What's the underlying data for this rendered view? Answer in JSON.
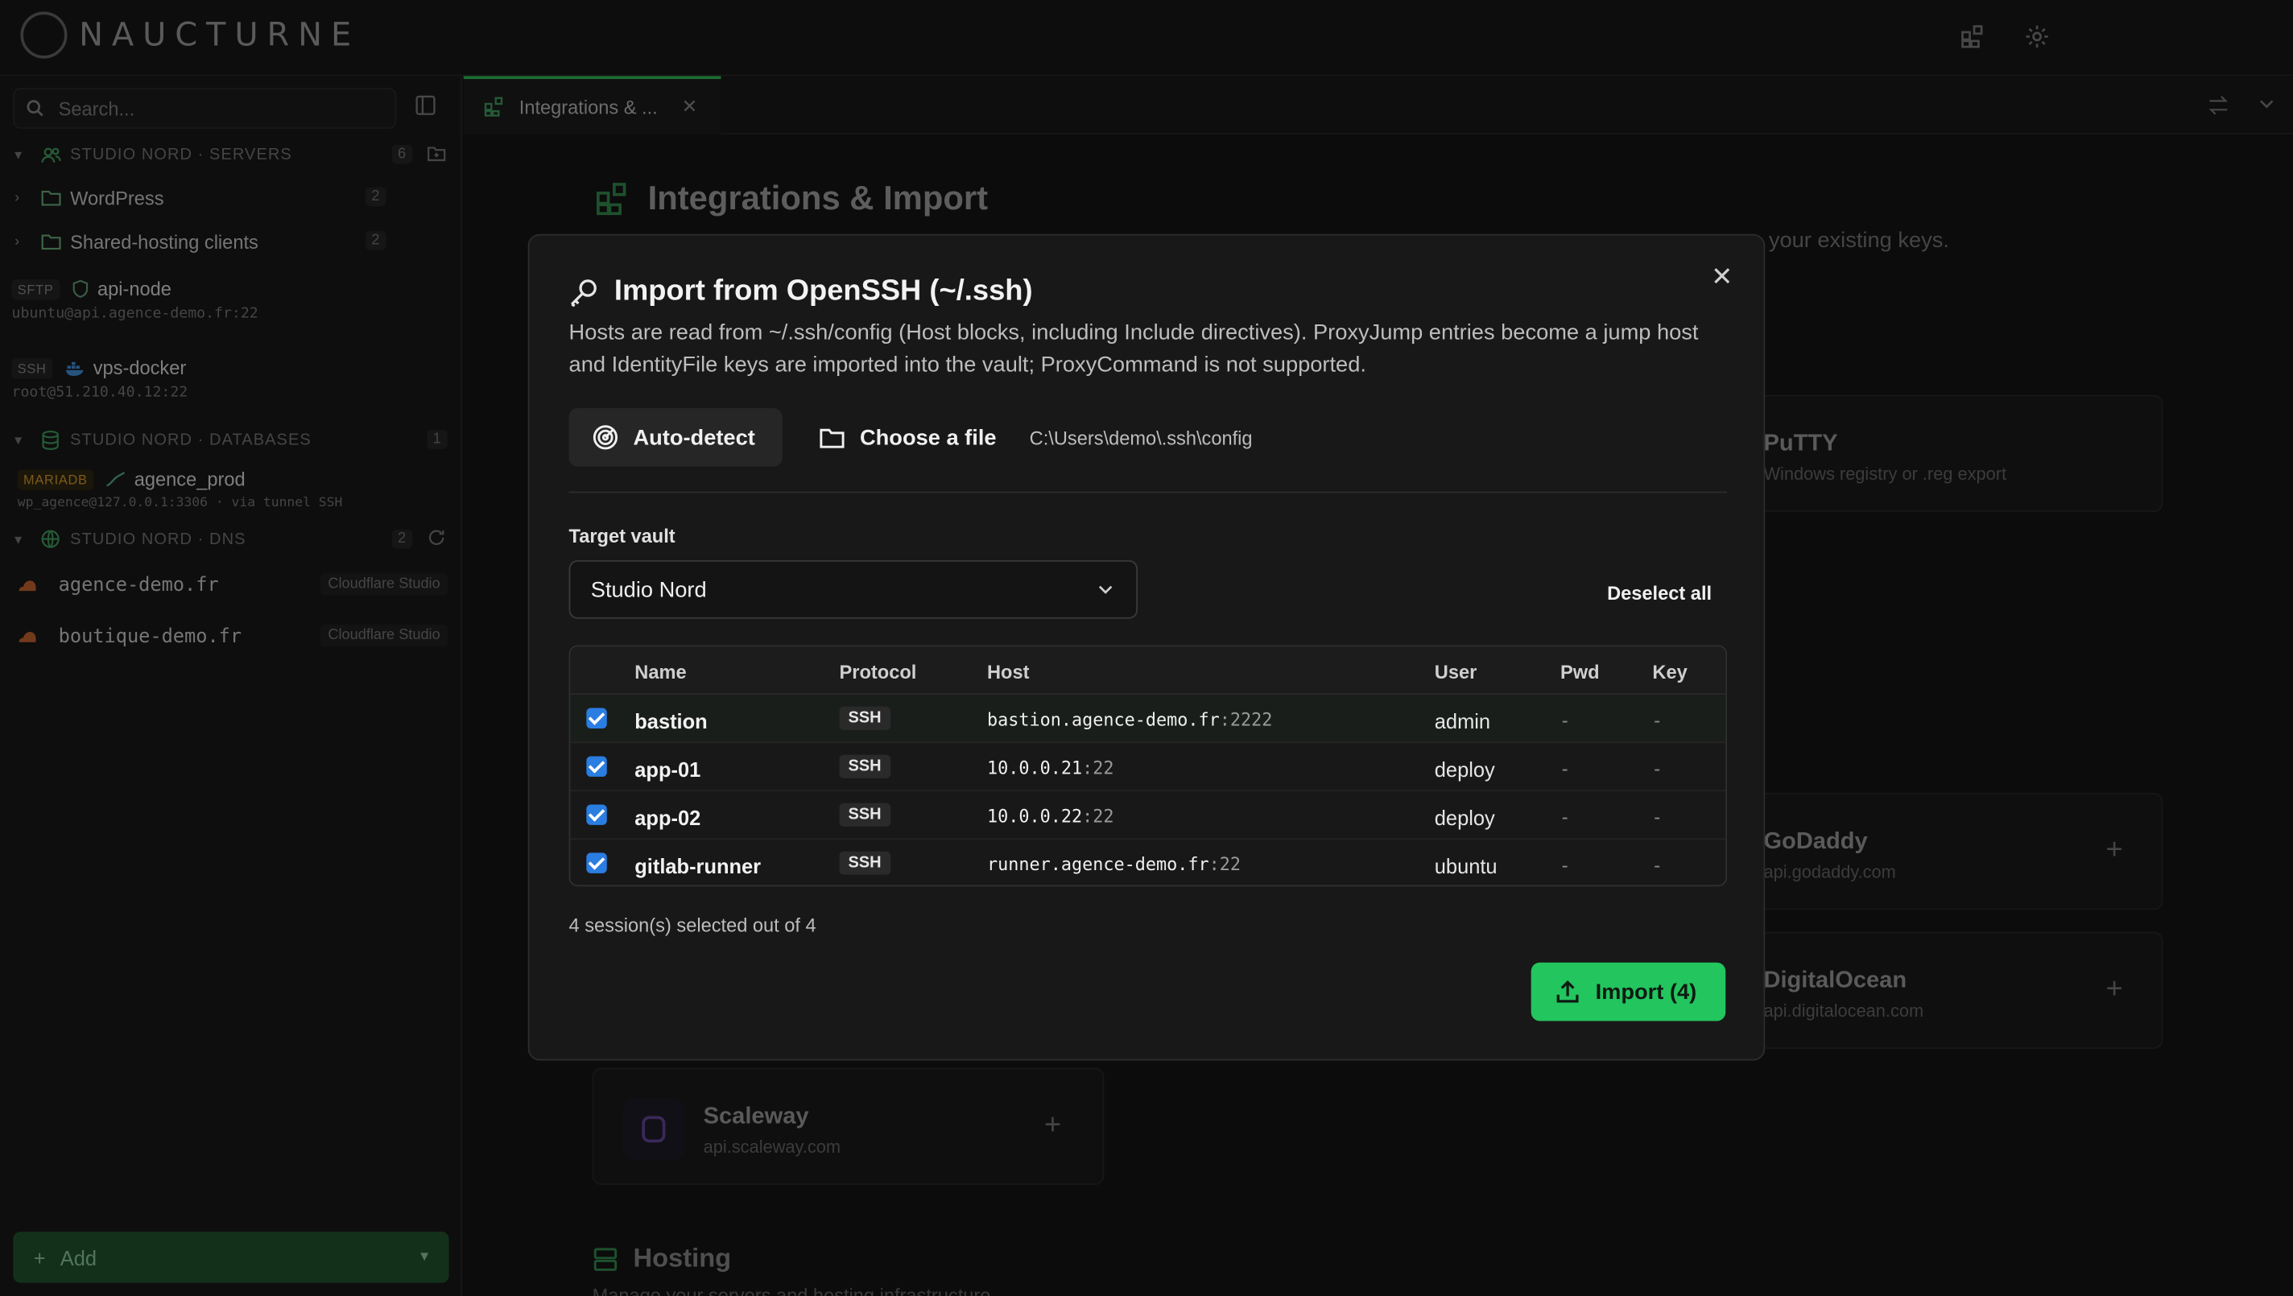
{
  "app": {
    "name": "NAUCTURNE"
  },
  "sidebar": {
    "search_placeholder": "Search...",
    "groups": [
      {
        "label": "STUDIO NORD · SERVERS",
        "count": "6"
      },
      {
        "label": "STUDIO NORD · DATABASES",
        "count": "1"
      },
      {
        "label": "STUDIO NORD · DNS",
        "count": "2"
      }
    ],
    "folders": [
      {
        "label": "WordPress",
        "count": "2"
      },
      {
        "label": "Shared-hosting clients",
        "count": "2"
      }
    ],
    "connections": [
      {
        "protocol": "SFTP",
        "name": "api-node",
        "detail": "ubuntu@api.agence-demo.fr:22"
      },
      {
        "protocol": "SSH",
        "name": "vps-docker",
        "detail": "root@51.210.40.12:22"
      }
    ],
    "database": {
      "badge": "MARIADB",
      "name": "agence_prod",
      "detail": "wp_agence@127.0.0.1:3306 · via tunnel SSH"
    },
    "dns": [
      {
        "name": "agence-demo.fr",
        "tag": "Cloudflare Studio"
      },
      {
        "name": "boutique-demo.fr",
        "tag": "Cloudflare Studio"
      }
    ],
    "add_label": "Add"
  },
  "tabs": [
    {
      "label": "Integrations & ..."
    }
  ],
  "page": {
    "title": "Integrations & Import",
    "subtitle_fragment": "e your existing keys.",
    "cards": [
      {
        "title": "PuTTY",
        "sub": "Windows registry or .reg export"
      },
      {
        "title": "GoDaddy",
        "sub": "api.godaddy.com"
      },
      {
        "title": "DigitalOcean",
        "sub": "api.digitalocean.com"
      },
      {
        "title": "Scaleway",
        "sub": "api.scaleway.com"
      }
    ],
    "hosting_title": "Hosting",
    "hosting_sub": "Manage your servers and hosting infrastructure"
  },
  "modal": {
    "title": "Import from OpenSSH (~/.ssh)",
    "description": "Hosts are read from ~/.ssh/config (Host blocks, including Include directives). ProxyJump entries become a jump host and IdentityFile keys are imported into the vault; ProxyCommand is not supported.",
    "auto_detect": "Auto-detect",
    "choose_file": "Choose a file",
    "path": "C:\\Users\\demo\\.ssh\\config",
    "target_vault_label": "Target vault",
    "target_vault_value": "Studio Nord",
    "deselect_all": "Deselect all",
    "columns": [
      "Name",
      "Protocol",
      "Host",
      "User",
      "Pwd",
      "Key"
    ],
    "rows": [
      {
        "checked": true,
        "name": "bastion",
        "protocol": "SSH",
        "host": "bastion.agence-demo.fr",
        "port": ":2222",
        "user": "admin",
        "pwd": "-",
        "key": "-"
      },
      {
        "checked": true,
        "name": "app-01",
        "protocol": "SSH",
        "host": "10.0.0.21",
        "port": ":22",
        "user": "deploy",
        "pwd": "-",
        "key": "-"
      },
      {
        "checked": true,
        "name": "app-02",
        "protocol": "SSH",
        "host": "10.0.0.22",
        "port": ":22",
        "user": "deploy",
        "pwd": "-",
        "key": "-"
      },
      {
        "checked": true,
        "name": "gitlab-runner",
        "protocol": "SSH",
        "host": "runner.agence-demo.fr",
        "port": ":22",
        "user": "ubuntu",
        "pwd": "-",
        "key": "-"
      }
    ],
    "selection_text": "4 session(s) selected out of 4",
    "import_label": "Import (4)"
  },
  "colors": {
    "accent": "#22c55e",
    "checkbox": "#2a7de1",
    "tab_indicator": "#2aa94e"
  }
}
